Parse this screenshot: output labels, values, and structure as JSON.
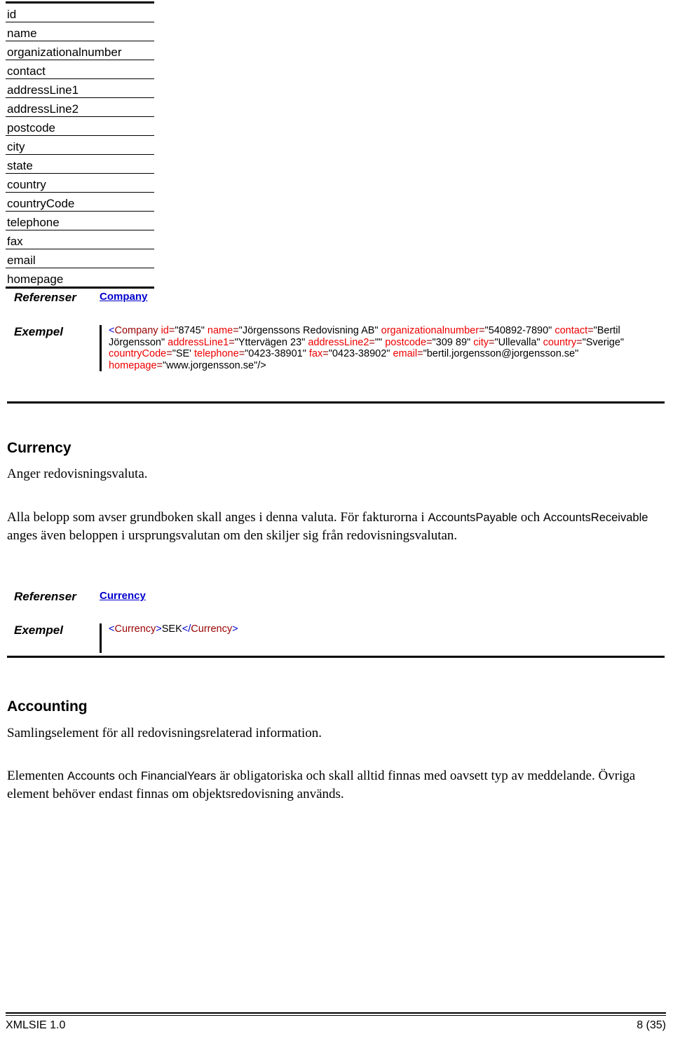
{
  "field_table": {
    "rows": [
      "id",
      "name",
      "organizationalnumber",
      "contact",
      "addressLine1",
      "addressLine2",
      "postcode",
      "city",
      "state",
      "country",
      "countryCode",
      "telephone",
      "fax",
      "email",
      "homepage"
    ]
  },
  "company_section": {
    "references_label": "Referenser",
    "reference_link": "Company",
    "example_label": "Exempel",
    "xml": {
      "open_bracket": "<",
      "tag": "Company",
      "attributes": [
        {
          "name": "id",
          "value": "\"8745\""
        },
        {
          "name": "name",
          "value": "\"Jörgenssons Redovisning AB\""
        },
        {
          "name": "organizationalnumber",
          "value": "\"540892-7890\""
        },
        {
          "name": "contact",
          "value": "\"Bertil Jörgensson\""
        },
        {
          "name": "addressLine1",
          "value": "\"Yttervägen 23\""
        },
        {
          "name": "addressLine2",
          "value": "\"\""
        },
        {
          "name": "postcode",
          "value": "\"309 89\""
        },
        {
          "name": "city",
          "value": "\"Ullevalla\""
        },
        {
          "name": "country",
          "value": "\"Sverige\""
        },
        {
          "name": "countryCode",
          "value": "\"SE'"
        },
        {
          "name": "telephone",
          "value": "\"0423-38901\""
        },
        {
          "name": "fax",
          "value": "\"0423-38902\""
        },
        {
          "name": "email",
          "value": "\"bertil.jorgensson@jorgensson.se\""
        },
        {
          "name": "homepage",
          "value": "\"www.jorgensson.se\""
        }
      ],
      "close": "/>"
    }
  },
  "currency_section": {
    "heading": "Currency",
    "intro": "Anger redovisningsvaluta.",
    "body_part1": "Alla belopp som avser grundboken skall anges i denna valuta. För fakturorna i ",
    "body_mono1": "AccountsPayable",
    "body_part2": " och ",
    "body_mono2": "AccountsReceivable",
    "body_part3": " anges även beloppen i ursprungsvalutan om den skiljer sig från redovisningsvalutan.",
    "references_label": "Referenser",
    "reference_link": "Currency",
    "example_label": "Exempel",
    "xml": {
      "open_bracket": "<",
      "open_tag": "Currency",
      "gt": ">",
      "text": "SEK",
      "close_bracket": "</",
      "close_tag": "Currency",
      "close_gt": ">"
    }
  },
  "accounting_section": {
    "heading": "Accounting",
    "intro": "Samlingselement för all redovisningsrelaterad information.",
    "body_part1": "Elementen ",
    "body_mono1": "Accounts",
    "body_part2": " och ",
    "body_mono2": "FinancialYears",
    "body_part3": " är obligatoriska och skall alltid finnas med oavsett typ av meddelande. Övriga element behöver endast finnas om objektsredovisning används."
  },
  "footer": {
    "left": "XMLSIE 1.0",
    "right": "8 (35)"
  }
}
